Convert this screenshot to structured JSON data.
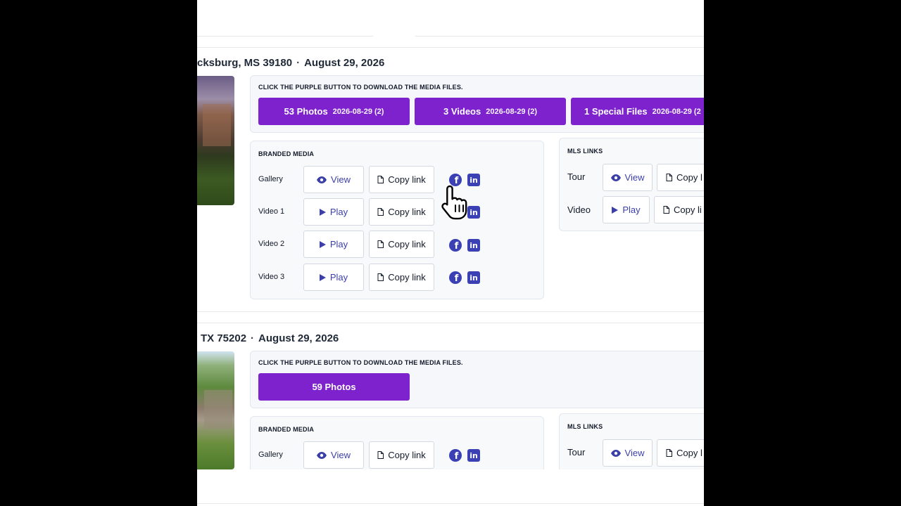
{
  "listings": [
    {
      "address": "cksburg, MS 39180",
      "date": "August 29, 2026",
      "download_note": "CLICK THE PURPLE BUTTON TO DOWNLOAD THE MEDIA FILES.",
      "downloads": [
        {
          "label": "53 Photos",
          "meta": "2026-08-29  (2)"
        },
        {
          "label": "3 Videos",
          "meta": "2026-08-29  (2)"
        },
        {
          "label": "1 Special Files",
          "meta": "2026-08-29  (2"
        }
      ],
      "branded": {
        "title": "BRANDED MEDIA",
        "rows": [
          {
            "label": "Gallery",
            "action": "View",
            "copy": "Copy link"
          },
          {
            "label": "Video 1",
            "action": "Play",
            "copy": "Copy link"
          },
          {
            "label": "Video 2",
            "action": "Play",
            "copy": "Copy link"
          },
          {
            "label": "Video 3",
            "action": "Play",
            "copy": "Copy link"
          }
        ]
      },
      "mls": {
        "title": "MLS LINKS",
        "rows": [
          {
            "label": "Tour",
            "action": "View",
            "copy": "Copy l"
          },
          {
            "label": "Video",
            "action": "Play",
            "copy": "Copy li"
          }
        ]
      }
    },
    {
      "address": "TX 75202",
      "date": "August 29, 2026",
      "download_note": "CLICK THE PURPLE BUTTON TO DOWNLOAD THE MEDIA FILES.",
      "downloads": [
        {
          "label": "59 Photos",
          "meta": ""
        }
      ],
      "branded": {
        "title": "BRANDED MEDIA",
        "rows": [
          {
            "label": "Gallery",
            "action": "View",
            "copy": "Copy link"
          }
        ]
      },
      "mls": {
        "title": "MLS LINKS",
        "rows": [
          {
            "label": "Tour",
            "action": "View",
            "copy": "Copy l"
          }
        ]
      }
    }
  ],
  "separator": "·",
  "colors": {
    "accent": "#7e22ce",
    "icon_blue": "#3b41b5"
  },
  "icons": {
    "view": "eye-icon",
    "play": "play-icon",
    "copy": "document-icon",
    "facebook": "facebook-icon",
    "linkedin": "linkedin-icon",
    "cursor": "hand-pointer-icon"
  }
}
